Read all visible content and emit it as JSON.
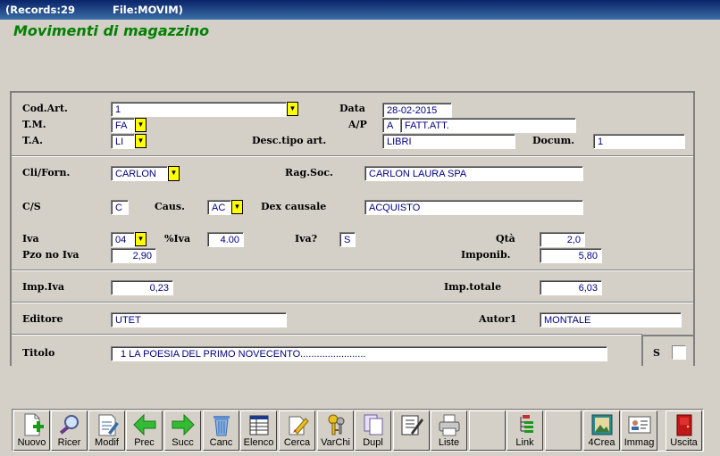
{
  "window": {
    "records": "(Records:29",
    "file": "File:MOVIM)"
  },
  "heading": "Movimenti di magazzino",
  "labels": {
    "cod_art": "Cod.Art.",
    "data": "Data",
    "tm": "T.M.",
    "ap": "A/P",
    "ta": "T.A.",
    "desc_tipo": "Desc.tipo art.",
    "docum": "Docum.",
    "cli_forn": "Cli/Forn.",
    "rag_soc": "Rag.Soc.",
    "cs": "C/S",
    "caus": "Caus.",
    "dex_causale": "Dex causale",
    "iva": "Iva",
    "perc_iva": "%Iva",
    "iva_q": "Iva?",
    "qta": "Qtà",
    "pzo_no_iva": "Pzo no Iva",
    "imponib": "Imponib.",
    "imp_iva": "Imp.Iva",
    "imp_totale": "Imp.totale",
    "editore": "Editore",
    "autore": "Autor1",
    "titolo": "Titolo",
    "s": "S"
  },
  "fields": {
    "cod_art": "1",
    "data": "28-02-2015",
    "tm": "FA",
    "ap_code": "A",
    "ap_desc": "FATT.ATT.",
    "ta": "LI",
    "desc_tipo": "LIBRI",
    "docum": "1",
    "cli_forn": "CARLON",
    "rag_soc": "CARLON LAURA SPA",
    "cs": "C",
    "caus": "AC",
    "dex_causale": "ACQUISTO",
    "iva": "04",
    "perc_iva": "4.00",
    "iva_q": "S",
    "qta": "2,0",
    "pzo_no_iva": "2,90",
    "imponib": "5,80",
    "imp_iva": "0,23",
    "imp_totale": "6,03",
    "editore": "UTET",
    "autore": "MONTALE",
    "titolo": "1 LA POESIA DEL PRIMO NOVECENTO........................"
  },
  "toolbar": [
    {
      "label": "Nuovo",
      "icon": "new-document-icon"
    },
    {
      "label": "Ricer",
      "icon": "magnifier-icon"
    },
    {
      "label": "Modif",
      "icon": "edit-document-icon"
    },
    {
      "label": "Prec",
      "icon": "arrow-left-icon"
    },
    {
      "label": "Succ",
      "icon": "arrow-right-icon"
    },
    {
      "label": "Canc",
      "icon": "trash-icon"
    },
    {
      "label": "Elenco",
      "icon": "table-icon"
    },
    {
      "label": "Cerca",
      "icon": "search-clear-icon"
    },
    {
      "label": "VarChi",
      "icon": "keys-icon"
    },
    {
      "label": "Dupl",
      "icon": "duplicate-icon"
    },
    {
      "label": "",
      "icon": "checklist-pen-icon"
    },
    {
      "label": "Liste",
      "icon": "printer-icon"
    },
    {
      "label": "",
      "icon": ""
    },
    {
      "label": "Link",
      "icon": "link-tree-icon"
    },
    {
      "label": "",
      "icon": ""
    },
    {
      "label": "4Crea",
      "icon": "picture-frame-icon"
    },
    {
      "label": "Immag",
      "icon": "id-card-icon"
    },
    {
      "label": "Uscita",
      "icon": "exit-door-icon"
    }
  ]
}
